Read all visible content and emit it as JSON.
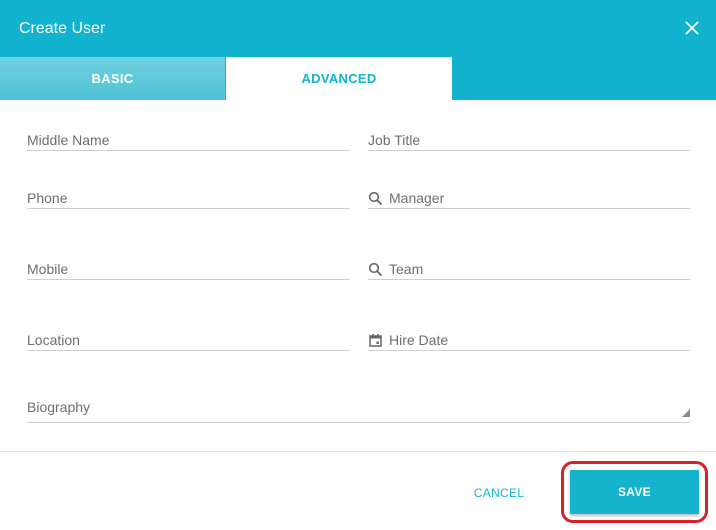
{
  "dialog": {
    "title": "Create User",
    "close_icon": "close-icon"
  },
  "tabs": [
    {
      "label": "BASIC",
      "active": false
    },
    {
      "label": "ADVANCED",
      "active": true
    }
  ],
  "fields": {
    "middle_name": {
      "placeholder": "Middle Name",
      "value": ""
    },
    "job_title": {
      "placeholder": "Job Title",
      "value": ""
    },
    "phone": {
      "placeholder": "Phone",
      "value": ""
    },
    "manager": {
      "placeholder": "Manager",
      "value": "",
      "icon": "search-icon"
    },
    "mobile": {
      "placeholder": "Mobile",
      "value": ""
    },
    "team": {
      "placeholder": "Team",
      "value": "",
      "icon": "search-icon"
    },
    "location": {
      "placeholder": "Location",
      "value": ""
    },
    "hire_date": {
      "placeholder": "Hire Date",
      "value": "",
      "icon": "calendar-icon"
    },
    "biography": {
      "placeholder": "Biography",
      "value": ""
    }
  },
  "actions": {
    "cancel_label": "CANCEL",
    "save_label": "SAVE"
  },
  "colors": {
    "accent": "#12b3cf",
    "highlight": "#d7202a"
  }
}
